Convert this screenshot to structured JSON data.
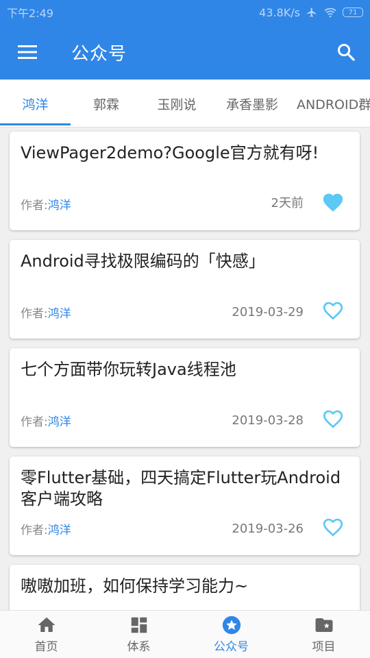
{
  "status": {
    "time": "下午2:49",
    "speed": "43.8K/s",
    "battery": "71"
  },
  "appbar": {
    "title": "公众号"
  },
  "tabs": [
    "鸿洋",
    "郭霖",
    "玉刚说",
    "承香墨影",
    "ANDROID群英传"
  ],
  "author_prefix": "作者:",
  "articles": [
    {
      "title": "ViewPager2demo?Google官方就有呀!",
      "author": "鸿洋",
      "date": "2天前",
      "liked": true
    },
    {
      "title": "Android寻找极限编码的「快感」",
      "author": "鸿洋",
      "date": "2019-03-29",
      "liked": false
    },
    {
      "title": "七个方面带你玩转Java线程池",
      "author": "鸿洋",
      "date": "2019-03-28",
      "liked": false
    },
    {
      "title": "零Flutter基础，四天搞定Flutter玩Android客户端攻略",
      "author": "鸿洋",
      "date": "2019-03-26",
      "liked": false
    },
    {
      "title": "嗷嗷加班，如何保持学习能力~",
      "author": "",
      "date": "",
      "liked": false
    }
  ],
  "bottomnav": [
    "首页",
    "体系",
    "公众号",
    "项目"
  ],
  "colors": {
    "primary": "#2f86e6",
    "heart": "#5bc8f5"
  }
}
